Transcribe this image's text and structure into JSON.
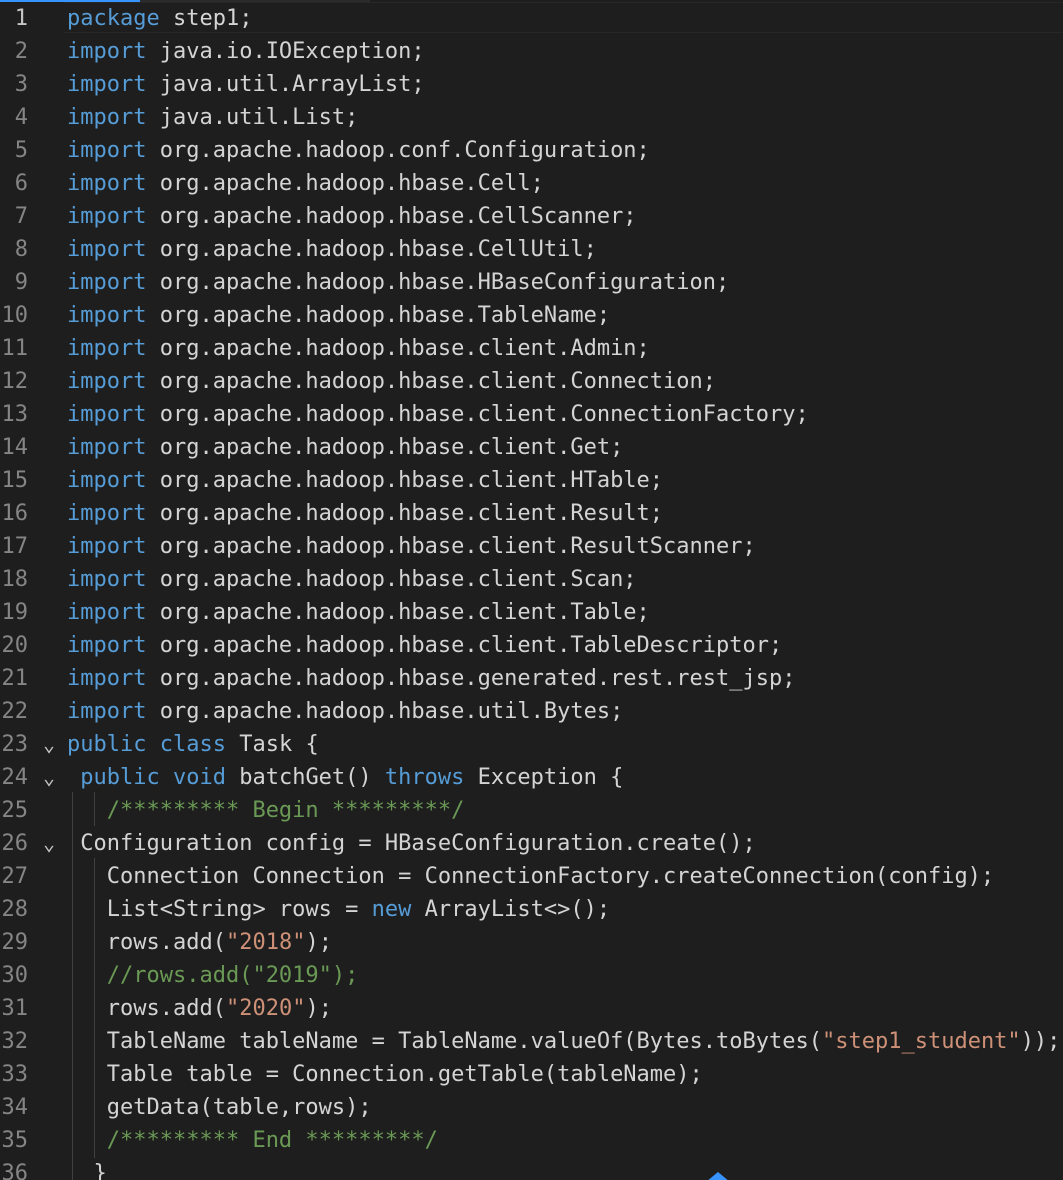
{
  "editor": {
    "lines": [
      {
        "n": "1",
        "fold": "",
        "indent": "",
        "parts": [
          [
            "kw",
            "package"
          ],
          [
            "ty",
            " step1;"
          ]
        ]
      },
      {
        "n": "2",
        "fold": "",
        "indent": "",
        "parts": [
          [
            "kw",
            "import"
          ],
          [
            "ty",
            " java.io.IOException;"
          ]
        ]
      },
      {
        "n": "3",
        "fold": "",
        "indent": "",
        "parts": [
          [
            "kw",
            "import"
          ],
          [
            "ty",
            " java.util.ArrayList;"
          ]
        ]
      },
      {
        "n": "4",
        "fold": "",
        "indent": "",
        "parts": [
          [
            "kw",
            "import"
          ],
          [
            "ty",
            " java.util.List;"
          ]
        ]
      },
      {
        "n": "5",
        "fold": "",
        "indent": "",
        "parts": [
          [
            "kw",
            "import"
          ],
          [
            "ty",
            " org.apache.hadoop.conf.Configuration;"
          ]
        ]
      },
      {
        "n": "6",
        "fold": "",
        "indent": "",
        "parts": [
          [
            "kw",
            "import"
          ],
          [
            "ty",
            " org.apache.hadoop.hbase.Cell;"
          ]
        ]
      },
      {
        "n": "7",
        "fold": "",
        "indent": "",
        "parts": [
          [
            "kw",
            "import"
          ],
          [
            "ty",
            " org.apache.hadoop.hbase.CellScanner;"
          ]
        ]
      },
      {
        "n": "8",
        "fold": "",
        "indent": "",
        "parts": [
          [
            "kw",
            "import"
          ],
          [
            "ty",
            " org.apache.hadoop.hbase.CellUtil;"
          ]
        ]
      },
      {
        "n": "9",
        "fold": "",
        "indent": "",
        "parts": [
          [
            "kw",
            "import"
          ],
          [
            "ty",
            " org.apache.hadoop.hbase.HBaseConfiguration;"
          ]
        ]
      },
      {
        "n": "10",
        "fold": "",
        "indent": "",
        "parts": [
          [
            "kw",
            "import"
          ],
          [
            "ty",
            " org.apache.hadoop.hbase.TableName;"
          ]
        ]
      },
      {
        "n": "11",
        "fold": "",
        "indent": "",
        "parts": [
          [
            "kw",
            "import"
          ],
          [
            "ty",
            " org.apache.hadoop.hbase.client.Admin;"
          ]
        ]
      },
      {
        "n": "12",
        "fold": "",
        "indent": "",
        "parts": [
          [
            "kw",
            "import"
          ],
          [
            "ty",
            " org.apache.hadoop.hbase.client.Connection;"
          ]
        ]
      },
      {
        "n": "13",
        "fold": "",
        "indent": "",
        "parts": [
          [
            "kw",
            "import"
          ],
          [
            "ty",
            " org.apache.hadoop.hbase.client.ConnectionFactory;"
          ]
        ]
      },
      {
        "n": "14",
        "fold": "",
        "indent": "",
        "parts": [
          [
            "kw",
            "import"
          ],
          [
            "ty",
            " org.apache.hadoop.hbase.client.Get;"
          ]
        ]
      },
      {
        "n": "15",
        "fold": "",
        "indent": "",
        "parts": [
          [
            "kw",
            "import"
          ],
          [
            "ty",
            " org.apache.hadoop.hbase.client.HTable;"
          ]
        ]
      },
      {
        "n": "16",
        "fold": "",
        "indent": "",
        "parts": [
          [
            "kw",
            "import"
          ],
          [
            "ty",
            " org.apache.hadoop.hbase.client.Result;"
          ]
        ]
      },
      {
        "n": "17",
        "fold": "",
        "indent": "",
        "parts": [
          [
            "kw",
            "import"
          ],
          [
            "ty",
            " org.apache.hadoop.hbase.client.ResultScanner;"
          ]
        ]
      },
      {
        "n": "18",
        "fold": "",
        "indent": "",
        "parts": [
          [
            "kw",
            "import"
          ],
          [
            "ty",
            " org.apache.hadoop.hbase.client.Scan;"
          ]
        ]
      },
      {
        "n": "19",
        "fold": "",
        "indent": "",
        "parts": [
          [
            "kw",
            "import"
          ],
          [
            "ty",
            " org.apache.hadoop.hbase.client.Table;"
          ]
        ]
      },
      {
        "n": "20",
        "fold": "",
        "indent": "",
        "parts": [
          [
            "kw",
            "import"
          ],
          [
            "ty",
            " org.apache.hadoop.hbase.client.TableDescriptor;"
          ]
        ]
      },
      {
        "n": "21",
        "fold": "",
        "indent": "",
        "parts": [
          [
            "kw",
            "import"
          ],
          [
            "ty",
            " org.apache.hadoop.hbase.generated.rest.rest_jsp;"
          ]
        ]
      },
      {
        "n": "22",
        "fold": "",
        "indent": "",
        "parts": [
          [
            "kw",
            "import"
          ],
          [
            "ty",
            " org.apache.hadoop.hbase.util.Bytes;"
          ]
        ]
      },
      {
        "n": "23",
        "fold": "⌄",
        "indent": "",
        "parts": [
          [
            "kw",
            "public"
          ],
          [
            "ty",
            " "
          ],
          [
            "kw",
            "class"
          ],
          [
            "ty",
            " Task {"
          ]
        ]
      },
      {
        "n": "24",
        "fold": "⌄",
        "indent": " ",
        "parts": [
          [
            "kw",
            "public"
          ],
          [
            "ty",
            " "
          ],
          [
            "kw",
            "void"
          ],
          [
            "ty",
            " batchGet() "
          ],
          [
            "kw",
            "throws"
          ],
          [
            "ty",
            " Exception {"
          ]
        ]
      },
      {
        "n": "25",
        "fold": "",
        "indent": "   ",
        "parts": [
          [
            "cm",
            "/********* Begin *********/"
          ]
        ]
      },
      {
        "n": "26",
        "fold": "⌄",
        "indent": " ",
        "parts": [
          [
            "ty",
            "Configuration config = HBaseConfiguration.create();"
          ]
        ]
      },
      {
        "n": "27",
        "fold": "",
        "indent": "   ",
        "parts": [
          [
            "ty",
            "Connection Connection = ConnectionFactory.createConnection(config);"
          ]
        ]
      },
      {
        "n": "28",
        "fold": "",
        "indent": "   ",
        "parts": [
          [
            "ty",
            "List<String> rows = "
          ],
          [
            "kw",
            "new"
          ],
          [
            "ty",
            " ArrayList<>();"
          ]
        ]
      },
      {
        "n": "29",
        "fold": "",
        "indent": "   ",
        "parts": [
          [
            "ty",
            "rows.add("
          ],
          [
            "str",
            "\"2018\""
          ],
          [
            "ty",
            ");"
          ]
        ]
      },
      {
        "n": "30",
        "fold": "",
        "indent": "   ",
        "parts": [
          [
            "cm",
            "//rows.add(\"2019\");"
          ]
        ]
      },
      {
        "n": "31",
        "fold": "",
        "indent": "   ",
        "parts": [
          [
            "ty",
            "rows.add("
          ],
          [
            "str",
            "\"2020\""
          ],
          [
            "ty",
            ");"
          ]
        ]
      },
      {
        "n": "32",
        "fold": "",
        "indent": "   ",
        "parts": [
          [
            "ty",
            "TableName tableName = TableName.valueOf(Bytes.toBytes("
          ],
          [
            "str",
            "\"step1_student\""
          ],
          [
            "ty",
            "));"
          ]
        ]
      },
      {
        "n": "33",
        "fold": "",
        "indent": "   ",
        "parts": [
          [
            "ty",
            "Table table = Connection.getTable(tableName);"
          ]
        ]
      },
      {
        "n": "34",
        "fold": "",
        "indent": "   ",
        "parts": [
          [
            "ty",
            "getData(table,rows);"
          ]
        ]
      },
      {
        "n": "35",
        "fold": "",
        "indent": "   ",
        "parts": [
          [
            "cm",
            "/********* End *********/"
          ]
        ]
      },
      {
        "n": "36",
        "fold": "",
        "indent": "  ",
        "parts": [
          [
            "ty",
            "}"
          ]
        ]
      }
    ]
  },
  "colors": {
    "background": "#1e1e1e",
    "keyword": "#569cd6",
    "string": "#ce9178",
    "comment": "#6a9955",
    "text": "#d4d4d4",
    "line_number": "#858585"
  }
}
